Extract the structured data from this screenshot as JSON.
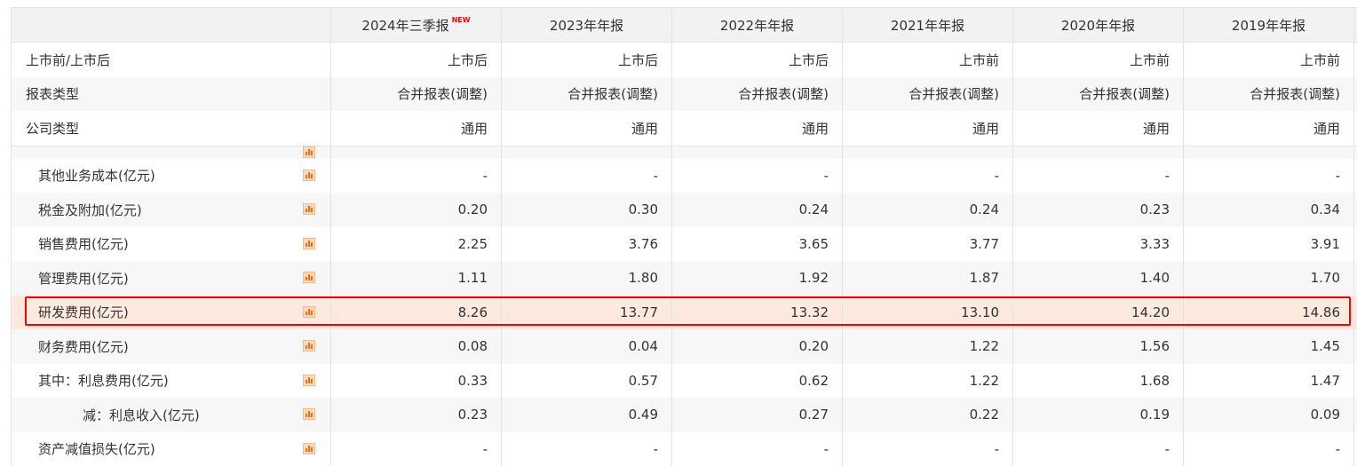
{
  "columns": [
    {
      "label": "2024年三季报",
      "badge": "NEW"
    },
    {
      "label": "2023年年报"
    },
    {
      "label": "2022年年报"
    },
    {
      "label": "2021年年报"
    },
    {
      "label": "2020年年报"
    },
    {
      "label": "2019年年报"
    }
  ],
  "meta_rows": [
    {
      "label": "上市前/上市后",
      "values": [
        "上市后",
        "上市后",
        "上市后",
        "上市前",
        "上市前",
        "上市前"
      ]
    },
    {
      "label": "报表类型",
      "values": [
        "合并报表(调整)",
        "合并报表(调整)",
        "合并报表(调整)",
        "合并报表(调整)",
        "合并报表(调整)",
        "合并报表(调整)"
      ]
    },
    {
      "label": "公司类型",
      "values": [
        "通用",
        "通用",
        "通用",
        "通用",
        "通用",
        "通用"
      ]
    }
  ],
  "rows": [
    {
      "label": "其他业务成本(亿元)",
      "values": [
        "-",
        "-",
        "-",
        "-",
        "-",
        "-"
      ]
    },
    {
      "label": "税金及附加(亿元)",
      "values": [
        "0.20",
        "0.30",
        "0.24",
        "0.24",
        "0.23",
        "0.34"
      ]
    },
    {
      "label": "销售费用(亿元)",
      "values": [
        "2.25",
        "3.76",
        "3.65",
        "3.77",
        "3.33",
        "3.91"
      ]
    },
    {
      "label": "管理费用(亿元)",
      "values": [
        "1.11",
        "1.80",
        "1.92",
        "1.87",
        "1.40",
        "1.70"
      ]
    },
    {
      "label": "研发费用(亿元)",
      "values": [
        "8.26",
        "13.77",
        "13.32",
        "13.10",
        "14.20",
        "14.86"
      ],
      "highlighted": true
    },
    {
      "label": "财务费用(亿元)",
      "values": [
        "0.08",
        "0.04",
        "0.20",
        "1.22",
        "1.56",
        "1.45"
      ]
    },
    {
      "label": "其中：利息费用(亿元)",
      "values": [
        "0.33",
        "0.57",
        "0.62",
        "1.22",
        "1.68",
        "1.47"
      ]
    },
    {
      "label": "减：利息收入(亿元)",
      "values": [
        "0.23",
        "0.49",
        "0.27",
        "0.22",
        "0.19",
        "0.09"
      ],
      "indent": true
    },
    {
      "label": "资产减值损失(亿元)",
      "values": [
        "-",
        "-",
        "-",
        "-",
        "-",
        "-"
      ]
    }
  ],
  "colors": {
    "highlight_bg": "#fde9dd",
    "highlight_border": "#ff0000",
    "chart_icon": "#f46b1c",
    "header_bg": "#f2f2f2"
  },
  "icons": {
    "row_chart": "bar-chart-icon"
  }
}
